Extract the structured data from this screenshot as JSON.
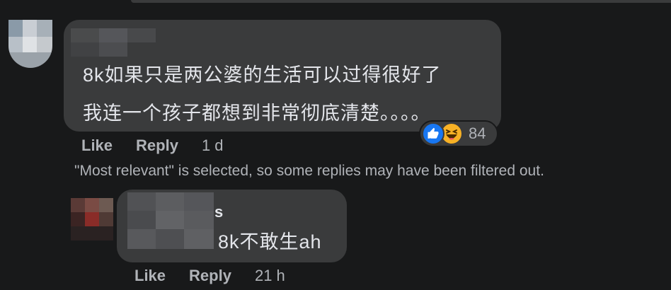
{
  "comment1": {
    "lines": [
      "8k如果只是两公婆的生活可以过得很好了",
      "我连一个孩子都想到非常彻底清楚。。。。"
    ],
    "reactions": {
      "icons": [
        "like-icon",
        "haha-icon"
      ],
      "count": "84"
    },
    "actions": {
      "like": "Like",
      "reply": "Reply",
      "time": "1 d"
    }
  },
  "filter_note": "\"Most relevant\" is selected, so some replies may have been filtered out.",
  "reply1": {
    "name_suffix": "s",
    "text": "8k不敢生ah",
    "actions": {
      "like": "Like",
      "reply": "Reply",
      "time": "21 h"
    }
  },
  "colors": {
    "background": "#18191a",
    "bubble": "#3a3b3c",
    "text_primary": "#e4e6eb",
    "text_secondary": "#b0b3b8",
    "like_blue": "#1877f2",
    "haha_yellow": "#f7b125"
  }
}
